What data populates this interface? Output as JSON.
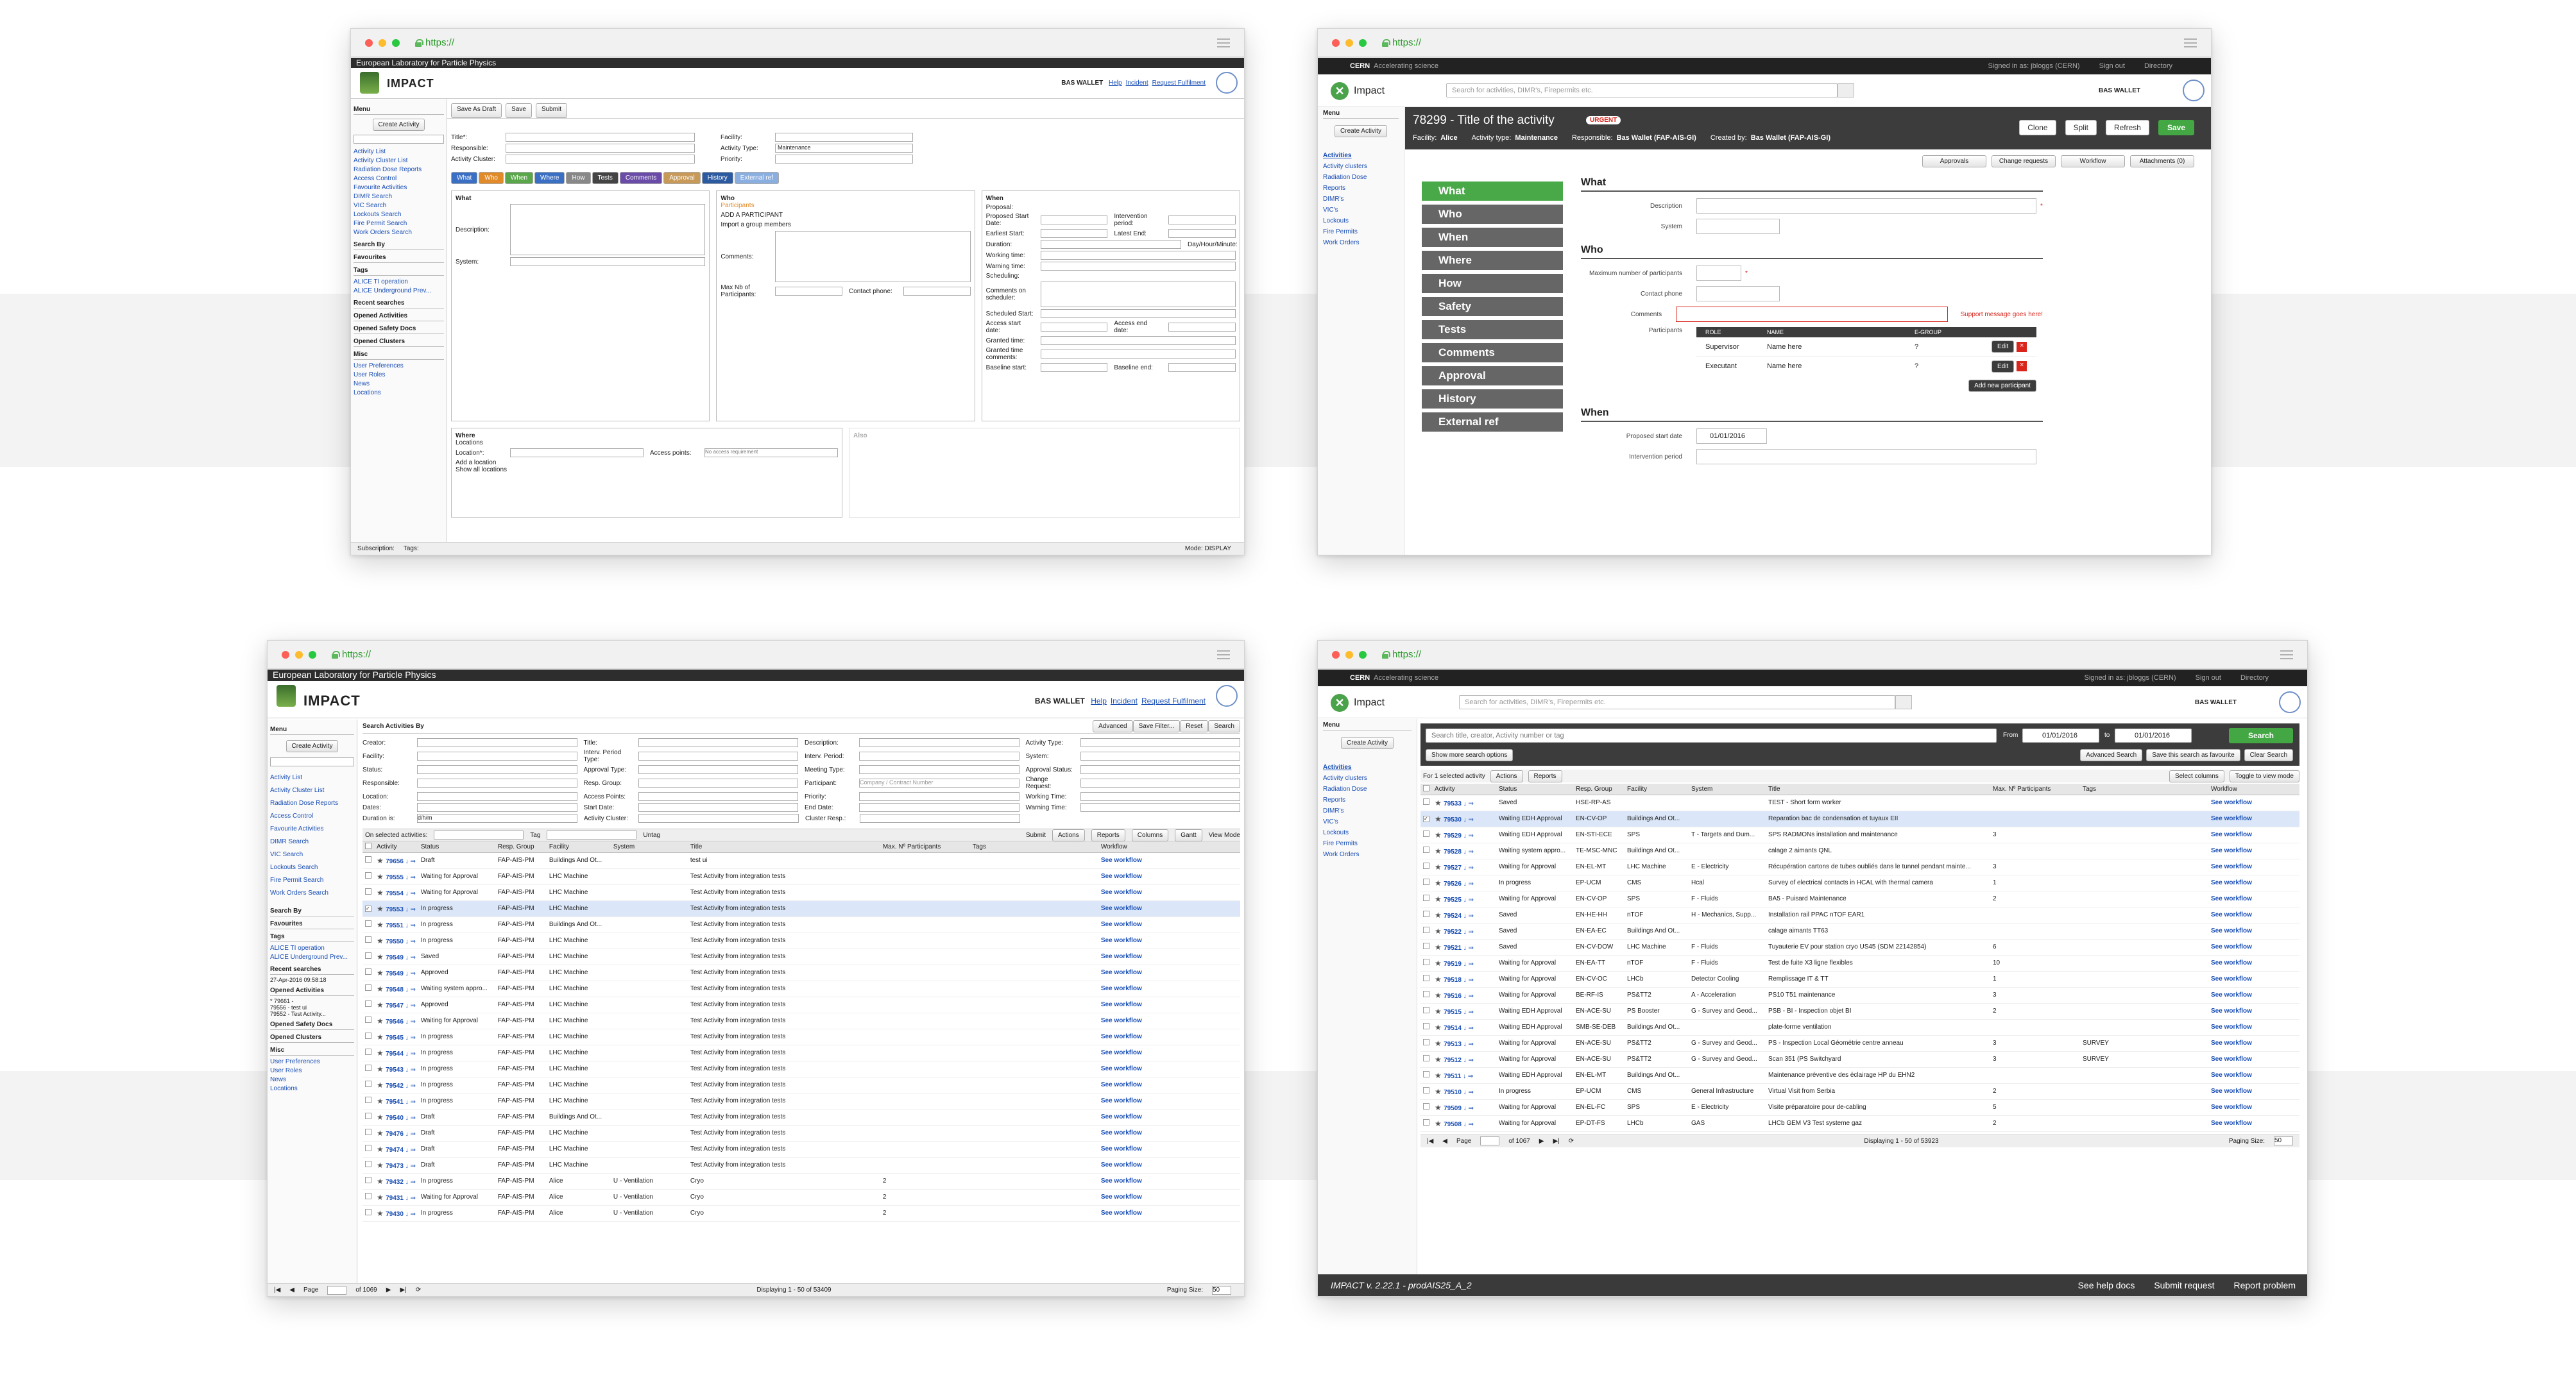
{
  "colors": {
    "accent_green": "#43a843",
    "link_blue": "#1a4fb5",
    "classic_bar": "#2d2d2d",
    "modern_bar": "#222222",
    "urgent_red": "#d9251c"
  },
  "browser": {
    "url": "https://"
  },
  "classic_form": {
    "lab": "European Laboratory for Particle Physics",
    "brand": "IMPACT",
    "user": "BAS WALLET",
    "links": [
      "Help",
      "Incident",
      "Request Fulfilment"
    ],
    "toolbar": [
      "Save As Draft",
      "Save",
      "Submit"
    ],
    "create": "Create Activity",
    "menu": "Menu",
    "side_links": [
      "Activity List",
      "Activity Cluster List",
      "Radiation Dose Reports",
      "Access Control",
      "Favourite Activities",
      "DIMR Search",
      "VIC Search",
      "Lockouts Search",
      "Fire Permit Search",
      "Work Orders Search"
    ],
    "side_heads": [
      "Search By",
      "Favourites",
      "Tags",
      "Recent searches",
      "Opened Activities",
      "Opened Safety Docs",
      "Opened Clusters",
      "Misc"
    ],
    "tags": [
      "ALICE TI operation",
      "ALICE Underground Prev..."
    ],
    "misc": [
      "User Preferences",
      "User Roles",
      "News",
      "Locations"
    ],
    "fields": [
      "Title*:",
      "Facility:",
      "Responsible:",
      "Activity Type:",
      "Activity Cluster:",
      "Priority:"
    ],
    "activity_type": "Maintenance",
    "tabs": [
      "What",
      "Who",
      "When",
      "Where",
      "How",
      "Tests",
      "Comments",
      "Approval",
      "History",
      "External ref"
    ],
    "sections": [
      "What",
      "Who",
      "When",
      "Where",
      "Also"
    ],
    "what_labels": [
      "Description:",
      "System:"
    ],
    "who_items": [
      "Participants",
      "ADD A PARTICIPANT",
      "Import a group members",
      "Comments:",
      "Max Nb of Participants:",
      "Contact phone:"
    ],
    "when_labels": [
      "Proposal:",
      "Proposed Start Date:",
      "Earliest Start:",
      "Duration:",
      "Working time:",
      "Warning time:",
      "Intervention period:",
      "Latest End:",
      "Day/Hour/Minute:",
      "Scheduling:",
      "Comments on scheduler:",
      "Scheduled Start:",
      "Access start date:",
      "Granted time:",
      "Granted time comments:",
      "Baseline start:",
      "Access end date:",
      "Baseline end:"
    ],
    "where_labels": [
      "Locations",
      "Location*:",
      "Access points:",
      "No access requirement",
      "Add a location",
      "Show all locations"
    ],
    "mode": "Mode: DISPLAY",
    "status_left": "Subscription:",
    "tags_label": "Tags:"
  },
  "modern_form": {
    "topbar": {
      "org": "CERN",
      "sub": "Accelerating science",
      "signed": "Signed in as: jbloggs (CERN)",
      "signout": "Sign out",
      "dir": "Directory"
    },
    "brand": "Impact",
    "search_placeholder": "Search for activities, DIMR's, Firepermits etc.",
    "user": "BAS WALLET",
    "menu": "Menu",
    "create": "Create Activity",
    "side_links": [
      "Activities",
      "Activity clusters",
      "Radiation Dose",
      "Reports",
      "DIMR's",
      "VIC's",
      "Lockouts",
      "Fire Permits",
      "Work Orders"
    ],
    "title": "78299 - Title of the activity",
    "urgent": "URGENT",
    "meta": {
      "facility_lbl": "Facility:",
      "facility": "Alice",
      "type_lbl": "Activity type:",
      "type": "Maintenance",
      "resp_lbl": "Responsible:",
      "resp": "Bas Wallet (FAP-AIS-GI)",
      "created_lbl": "Created by:",
      "created": "Bas Wallet (FAP-AIS-GI)"
    },
    "buttons": [
      "Clone",
      "Split",
      "Refresh",
      "Save"
    ],
    "subtabs": [
      "Approvals",
      "Change requests",
      "Workflow",
      "Attachments (0)"
    ],
    "nav": [
      "What",
      "Who",
      "When",
      "Where",
      "How",
      "Safety",
      "Tests",
      "Comments",
      "Approval",
      "History",
      "External ref"
    ],
    "what": {
      "title": "What",
      "labels": [
        "Description",
        "System"
      ]
    },
    "who": {
      "title": "Who",
      "labels": [
        "Maximum number of participants",
        "Contact phone",
        "Comments",
        "Participants"
      ],
      "error": "Support message goes here!",
      "cols": [
        "ROLE",
        "NAME",
        "E-GROUP"
      ],
      "rows": [
        [
          "Supervisor",
          "Name here",
          "?"
        ],
        [
          "Executant",
          "Name here",
          "?"
        ]
      ],
      "edit": "Edit",
      "add": "Add new participant"
    },
    "when": {
      "title": "When",
      "labels": [
        "Proposed start date",
        "Intervention period"
      ],
      "date": "01/01/2016"
    }
  },
  "classic_list": {
    "lab": "European Laboratory for Particle Physics",
    "brand": "IMPACT",
    "user": "BAS WALLET",
    "links": [
      "Help",
      "Incident",
      "Request Fulfilment"
    ],
    "title": "Search Activities By",
    "actions": [
      "Advanced",
      "Save Filter...",
      "Reset",
      "Search"
    ],
    "menu": "Menu",
    "create": "Create Activity",
    "side_links": [
      "Activity List",
      "Activity Cluster List",
      "Radiation Dose Reports",
      "Access Control",
      "Favourite Activities",
      "DIMR Search",
      "VIC Search",
      "Lockouts Search",
      "Fire Permit Search",
      "Work Orders Search"
    ],
    "side_heads": [
      "Search By",
      "Favourites",
      "Tags",
      "Recent searches",
      "Opened Activities",
      "Opened Safety Docs",
      "Opened Clusters",
      "Misc"
    ],
    "tags": [
      "ALICE TI operation",
      "ALICE Underground Prev..."
    ],
    "recent": [
      "27-Apr-2016 09:58:18"
    ],
    "opened": [
      "* 79661 -",
      "79556 - test ui",
      "79552 - Test Activity..."
    ],
    "misc": [
      "User Preferences",
      "User Roles",
      "News",
      "Locations"
    ],
    "filters": [
      [
        "Creator:",
        "Title:",
        "Description:",
        "Activity Type:"
      ],
      [
        "Facility:",
        "Interv. Period Type:",
        "Interv. Period:",
        "System:"
      ],
      [
        "Status:",
        "Approval Type:",
        "Meeting Type:",
        "Approval Status:"
      ],
      [
        "Responsible:",
        "Resp. Group:",
        "Participant:",
        "Change Request:"
      ],
      [
        "Location:",
        "Access Points:",
        "Priority:",
        "Working Time:"
      ],
      [
        "Dates:",
        "Start Date:",
        "End Date:",
        "Warning Time:"
      ],
      [
        "Duration is:",
        "Activity Cluster:",
        "Cluster Resp.:",
        ""
      ]
    ],
    "contract_ph": "Company / Contract Number",
    "duration_unit": "d/h/m",
    "bar": {
      "on_selected": "On selected activities:",
      "tag": "Tag",
      "untag": "Untag",
      "submit": "Submit",
      "actions": "Actions",
      "reports": "Reports",
      "columns": "Columns",
      "gantt": "Gantt",
      "view": "View Mode"
    },
    "cols": [
      "Activity",
      "Status",
      "Resp. Group",
      "Facility",
      "System",
      "Title",
      "Max. Nº Participants",
      "Tags",
      "Workflow"
    ],
    "rows": [
      [
        "79656",
        "Draft",
        "FAP-AIS-PM",
        "Buildings And Ot...",
        "",
        "test ui",
        "",
        "",
        "See workflow"
      ],
      [
        "79555",
        "Waiting for Approval",
        "FAP-AIS-PM",
        "LHC Machine",
        "",
        "Test Activity from integration tests",
        "",
        "",
        "See workflow"
      ],
      [
        "79554",
        "Waiting for Approval",
        "FAP-AIS-PM",
        "LHC Machine",
        "",
        "Test Activity from integration tests",
        "",
        "",
        "See workflow"
      ],
      [
        "79553",
        "In progress",
        "FAP-AIS-PM",
        "LHC Machine",
        "",
        "Test Activity from integration tests",
        "",
        "",
        "See workflow"
      ],
      [
        "79551",
        "In progress",
        "FAP-AIS-PM",
        "Buildings And Ot...",
        "",
        "Test Activity from integration tests",
        "",
        "",
        "See workflow"
      ],
      [
        "79550",
        "In progress",
        "FAP-AIS-PM",
        "LHC Machine",
        "",
        "Test Activity from integration tests",
        "",
        "",
        "See workflow"
      ],
      [
        "79549",
        "Saved",
        "FAP-AIS-PM",
        "LHC Machine",
        "",
        "Test Activity from integration tests",
        "",
        "",
        "See workflow"
      ],
      [
        "79549",
        "Approved",
        "FAP-AIS-PM",
        "LHC Machine",
        "",
        "Test Activity from integration tests",
        "",
        "",
        "See workflow"
      ],
      [
        "79548",
        "Waiting system appro...",
        "FAP-AIS-PM",
        "LHC Machine",
        "",
        "Test Activity from integration tests",
        "",
        "",
        "See workflow"
      ],
      [
        "79547",
        "Approved",
        "FAP-AIS-PM",
        "LHC Machine",
        "",
        "Test Activity from integration tests",
        "",
        "",
        "See workflow"
      ],
      [
        "79546",
        "Waiting for Approval",
        "FAP-AIS-PM",
        "LHC Machine",
        "",
        "Test Activity from integration tests",
        "",
        "",
        "See workflow"
      ],
      [
        "79545",
        "In progress",
        "FAP-AIS-PM",
        "LHC Machine",
        "",
        "Test Activity from integration tests",
        "",
        "",
        "See workflow"
      ],
      [
        "79544",
        "In progress",
        "FAP-AIS-PM",
        "LHC Machine",
        "",
        "Test Activity from integration tests",
        "",
        "",
        "See workflow"
      ],
      [
        "79543",
        "In progress",
        "FAP-AIS-PM",
        "LHC Machine",
        "",
        "Test Activity from integration tests",
        "",
        "",
        "See workflow"
      ],
      [
        "79542",
        "In progress",
        "FAP-AIS-PM",
        "LHC Machine",
        "",
        "Test Activity from integration tests",
        "",
        "",
        "See workflow"
      ],
      [
        "79541",
        "In progress",
        "FAP-AIS-PM",
        "LHC Machine",
        "",
        "Test Activity from integration tests",
        "",
        "",
        "See workflow"
      ],
      [
        "79540",
        "Draft",
        "FAP-AIS-PM",
        "Buildings And Ot...",
        "",
        "Test Activity from integration tests",
        "",
        "",
        "See workflow"
      ],
      [
        "79476",
        "Draft",
        "FAP-AIS-PM",
        "LHC Machine",
        "",
        "Test Activity from integration tests",
        "",
        "",
        "See workflow"
      ],
      [
        "79474",
        "Draft",
        "FAP-AIS-PM",
        "LHC Machine",
        "",
        "Test Activity from integration tests",
        "",
        "",
        "See workflow"
      ],
      [
        "79473",
        "Draft",
        "FAP-AIS-PM",
        "LHC Machine",
        "",
        "Test Activity from integration tests",
        "",
        "",
        "See workflow"
      ],
      [
        "79432",
        "In progress",
        "FAP-AIS-PM",
        "Alice",
        "U - Ventilation",
        "Cryo",
        "2",
        "",
        "See workflow"
      ],
      [
        "79431",
        "Waiting for Approval",
        "FAP-AIS-PM",
        "Alice",
        "U - Ventilation",
        "Cryo",
        "2",
        "",
        "See workflow"
      ],
      [
        "79430",
        "In progress",
        "FAP-AIS-PM",
        "Alice",
        "U - Ventilation",
        "Cryo",
        "2",
        "",
        "See workflow"
      ]
    ],
    "pager": {
      "page": "Page",
      "of": "of 1069",
      "display": "Displaying 1 - 50 of 53409",
      "size_lbl": "Paging Size:",
      "size": "50"
    }
  },
  "modern_list": {
    "topbar": {
      "org": "CERN",
      "sub": "Accelerating science",
      "signed": "Signed in as: jbloggs (CERN)",
      "signout": "Sign out",
      "dir": "Directory"
    },
    "brand": "Impact",
    "search_placeholder": "Search for activities, DIMR's, Firepermits etc.",
    "user": "BAS WALLET",
    "menu": "Menu",
    "create": "Create Activity",
    "side_links": [
      "Activities",
      "Activity clusters",
      "Radiation Dose",
      "Reports",
      "DIMR's",
      "VIC's",
      "Lockouts",
      "Fire Permits",
      "Work Orders"
    ],
    "filter_ph": "Search title, creator, Activity number or tag",
    "from": "From",
    "to": "to",
    "date_from": "01/01/2016",
    "date_to": "01/01/2016",
    "search": "Search",
    "more": "Show more search options",
    "links": [
      "Advanced Search",
      "Save this search as favourite",
      "Clear Search"
    ],
    "selected": "For 1 selected activity",
    "actions": "Actions",
    "reports": "Reports",
    "select_cols": "Select columns",
    "toggle": "Toggle to view mode",
    "cols": [
      "Activity",
      "Status",
      "Resp. Group",
      "Facility",
      "System",
      "Title",
      "Max. Nº Participants",
      "Tags",
      "Workflow"
    ],
    "rows": [
      [
        "79533",
        "Saved",
        "HSE-RP-AS",
        "",
        "",
        "TEST - Short form worker",
        "",
        "",
        "See workflow"
      ],
      [
        "79530",
        "Waiting EDH Approval",
        "EN-CV-OP",
        "Buildings And Ot...",
        "",
        "Reparation bac de condensation et tuyaux EII",
        "",
        "",
        "See workflow"
      ],
      [
        "79529",
        "Waiting EDH Approval",
        "EN-STI-ECE",
        "SPS",
        "T - Targets and Dum...",
        "SPS RADMONs installation and maintenance",
        "3",
        "",
        "See workflow"
      ],
      [
        "79528",
        "Waiting system appro...",
        "TE-MSC-MNC",
        "Buildings And Ot...",
        "",
        "calage 2 aimants QNL",
        "",
        "",
        "See workflow"
      ],
      [
        "79527",
        "Waiting for Approval",
        "EN-EL-MT",
        "LHC Machine",
        "E - Electricity",
        "Récupération cartons de tubes oubliés dans le tunnel pendant mainte...",
        "3",
        "",
        "See workflow"
      ],
      [
        "79526",
        "In progress",
        "EP-UCM",
        "CMS",
        "Hcal",
        "Survey of electrical contacts in HCAL with thermal camera",
        "1",
        "",
        "See workflow"
      ],
      [
        "79525",
        "Waiting for Approval",
        "EN-CV-OP",
        "SPS",
        "F - Fluids",
        "BA5 - Puisard Maintenance",
        "2",
        "",
        "See workflow"
      ],
      [
        "79524",
        "Saved",
        "EN-HE-HH",
        "nTOF",
        "H - Mechanics, Supp...",
        "Installation rail PPAC nTOF EAR1",
        "",
        "",
        "See workflow"
      ],
      [
        "79522",
        "Saved",
        "EN-EA-EC",
        "Buildings And Ot...",
        "",
        "calage aimants TT63",
        "",
        "",
        "See workflow"
      ],
      [
        "79521",
        "Saved",
        "EN-CV-DOW",
        "LHC Machine",
        "F - Fluids",
        "Tuyauterie EV pour station cryo US45 (SDM 22142854)",
        "6",
        "",
        "See workflow"
      ],
      [
        "79519",
        "Waiting for Approval",
        "EN-EA-TT",
        "nTOF",
        "F - Fluids",
        "Test de fuite X3 ligne flexibles",
        "10",
        "",
        "See workflow"
      ],
      [
        "79518",
        "Waiting for Approval",
        "EN-CV-OC",
        "LHCb",
        "Detector Cooling",
        "Remplissage IT & TT",
        "1",
        "",
        "See workflow"
      ],
      [
        "79516",
        "Waiting for Approval",
        "BE-RF-IS",
        "PS&TT2",
        "A - Acceleration",
        "PS10 T51 maintenance",
        "3",
        "",
        "See workflow"
      ],
      [
        "79515",
        "Waiting EDH Approval",
        "EN-ACE-SU",
        "PS Booster",
        "G - Survey and Geod...",
        "PSB - BI - Inspection objet BI",
        "2",
        "",
        "See workflow"
      ],
      [
        "79514",
        "Waiting EDH Approval",
        "SMB-SE-DEB",
        "Buildings And Ot...",
        "",
        "plate-forme ventilation",
        "",
        "",
        "See workflow"
      ],
      [
        "79513",
        "Waiting for Approval",
        "EN-ACE-SU",
        "PS&TT2",
        "G - Survey and Geod...",
        "PS - Inspection Local Géométrie centre anneau",
        "3",
        "SURVEY",
        "See workflow"
      ],
      [
        "79512",
        "Waiting for Approval",
        "EN-ACE-SU",
        "PS&TT2",
        "G - Survey and Geod...",
        "Scan 351 (PS Switchyard",
        "3",
        "SURVEY",
        "See workflow"
      ],
      [
        "79511",
        "Waiting EDH Approval",
        "EN-EL-MT",
        "Buildings And Ot...",
        "",
        "Maintenance préventive des éclairage HP du EHN2",
        "",
        "",
        "See workflow"
      ],
      [
        "79510",
        "In progress",
        "EP-UCM",
        "CMS",
        "General Infrastructure",
        "Virtual Visit from Serbia",
        "2",
        "",
        "See workflow"
      ],
      [
        "79509",
        "Waiting for Approval",
        "EN-EL-FC",
        "SPS",
        "E - Electricity",
        "Visite préparatoire pour de-cabling",
        "5",
        "",
        "See workflow"
      ],
      [
        "79508",
        "Waiting for Approval",
        "EP-DT-FS",
        "LHCb",
        "GAS",
        "LHCb GEM V3 Test systeme gaz",
        "2",
        "",
        "See workflow"
      ]
    ],
    "pager": {
      "page": "Page",
      "of": "of 1067",
      "display": "Displaying 1 - 50 of 53923",
      "size_lbl": "Paging Size:",
      "size": "50"
    },
    "footer": {
      "version": "IMPACT v. 2.22.1 - prodAIS25_A_2",
      "links": [
        "See help docs",
        "Submit request",
        "Report problem"
      ]
    }
  }
}
